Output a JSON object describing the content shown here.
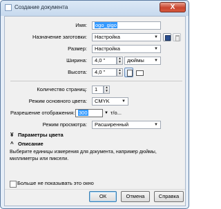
{
  "window": {
    "title": "Создание документа",
    "close_label": "X"
  },
  "form": {
    "name_label": "Имя:",
    "name_value": "ogo_gigo",
    "preset_label": "Назначение заготовки:",
    "preset_value": "Настройка",
    "size_label": "Размер:",
    "size_value": "Настройка",
    "width_label": "Ширина:",
    "width_value": "4,0 \"",
    "unit_value": "дюймы",
    "height_label": "Высота:",
    "height_value": "4,0 \"",
    "pages_label": "Количество страниц:",
    "pages_value": "1",
    "color_mode_label": "Режим основного цвета:",
    "color_mode_value": "CMYK",
    "resolution_label": "Разрешение отображения:",
    "resolution_value": "300",
    "resolution_suffix": "т/о...",
    "preview_label": "Режим просмотра:",
    "preview_value": "Расширенный"
  },
  "sections": {
    "color_params": "Параметры цвета",
    "description": "Описание"
  },
  "description_text": "Выберите единицы измерения для документа, например дюймы, миллиметры или пиксели.",
  "dont_show_label": "Больше не показывать это окно",
  "buttons": {
    "ok": "ОК",
    "cancel": "Отмена",
    "help": "Справка"
  }
}
